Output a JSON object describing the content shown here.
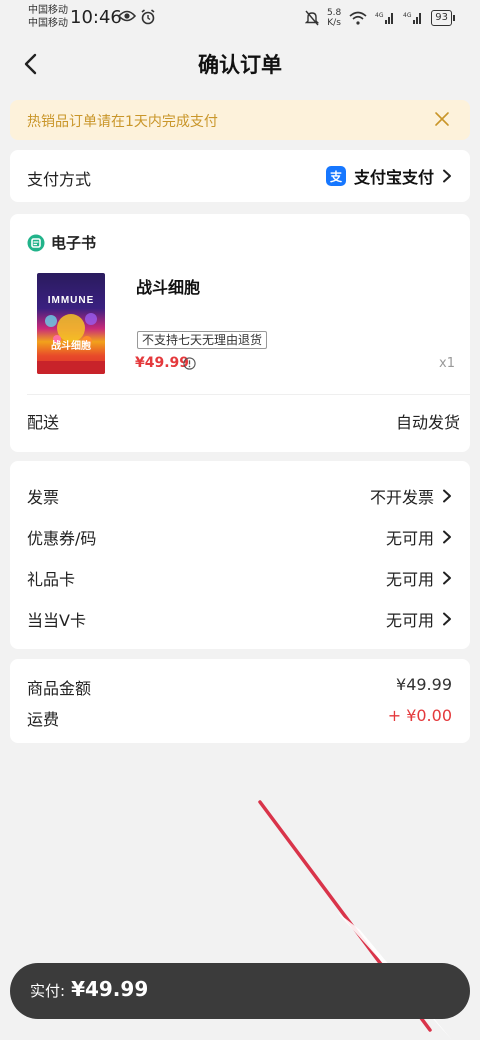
{
  "status_bar": {
    "carrier1": "中国移动",
    "carrier2": "中国移动",
    "time": "10:46",
    "speed_value": "5.8",
    "speed_unit": "K/s",
    "battery": "93"
  },
  "header": {
    "title": "确认订单"
  },
  "notice": {
    "text": "热销品订单请在1天内完成支付"
  },
  "payment": {
    "label": "支付方式",
    "method": "支付宝支付",
    "alipay_glyph": "支"
  },
  "ebook": {
    "section_title": "电子书",
    "cover_en": "IMMUNE",
    "cover_cn": "战斗细胞",
    "title": "战斗细胞",
    "tag": "不支持七天无理由退货",
    "price": "¥49.99",
    "quantity": "x1",
    "delivery_label": "配送",
    "delivery_value": "自动发货"
  },
  "options": [
    {
      "label": "发票",
      "value": "不开发票"
    },
    {
      "label": "优惠券/码",
      "value": "无可用"
    },
    {
      "label": "礼品卡",
      "value": "无可用"
    },
    {
      "label": "当当V卡",
      "value": "无可用"
    }
  ],
  "summary": {
    "goods_label": "商品金额",
    "goods_value": "¥49.99",
    "shipping_label": "运费",
    "shipping_value": "+ ¥0.00"
  },
  "bottom": {
    "pay_label": "实付:",
    "pay_amount": "¥49.99"
  },
  "colors": {
    "accent_red": "#e4393c",
    "notice_bg": "#fdf2db",
    "notice_text": "#c9962a",
    "alipay_blue": "#1677ff",
    "ebook_green": "#21b38a",
    "annotation_red": "#d9344a"
  },
  "icons": {
    "back": "chevron-left-icon",
    "close": "close-icon",
    "chevron": "chevron-right-icon",
    "info": "info-circle-icon",
    "ebook": "ebook-icon"
  }
}
